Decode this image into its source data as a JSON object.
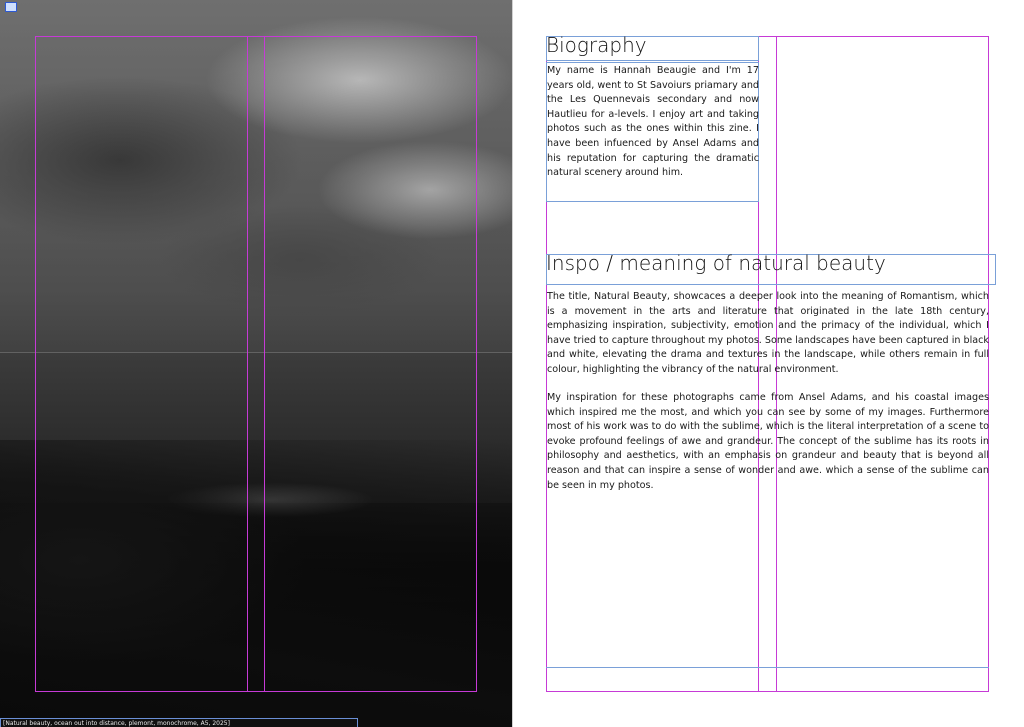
{
  "photo_caption": "[Natural beauty, ocean out into distance, plemont, monochrome, A5, 2025]",
  "biography": {
    "heading": "Biography",
    "text": "My name is Hannah Beaugie and I'm 17 years old, went to St Savoiurs priamary and the Les Quennevais secondary and now Hautlieu for a-levels. I enjoy art and taking photos such as the ones within this zine. I have been infuenced by Ansel Adams and his reputation for capturing the dramatic natural scenery around him."
  },
  "inspo": {
    "heading": "Inspo / meaning of natural beauty",
    "paragraph1": "The title, Natural Beauty, showcaces a deeper look into the meaning of Romantism, which is a movement in the arts and literature that originated in the late 18th century, emphasizing inspiration, subjectivity, emotion and the primacy of the individual, which I have tried to capture throughout my photos. Some landscapes have been captured in black and white, elevating the drama and textures in the landscape, while others remain in full colour, highlighting the vibrancy of the natural environment.",
    "paragraph2": "My inspiration for these photographs came from Ansel Adams,  and his coastal images which inspired me the most, and which you can see by some of my images. Furthermore most of his work was to do with the sublime, which is the literal interpretation of a scene to evoke profound feelings of awe and grandeur. The concept of the sublime has its roots in philosophy and aesthetics, with an emphasis on grandeur and beauty that is beyond all reason and that can inspire a sense of wonder and awe. which a sense of the sublime can be seen in my photos."
  },
  "colors": {
    "margin_guide": "#c63ad6",
    "frame_outline": "#7aa0d8",
    "text": "#1a1a1a"
  }
}
